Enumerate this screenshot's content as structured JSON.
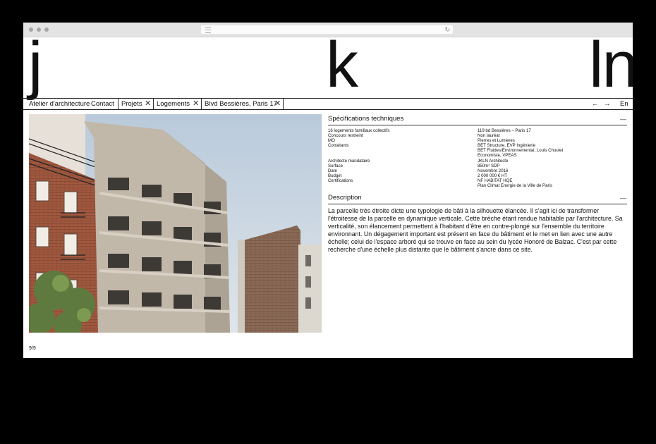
{
  "header": {
    "letter_1": "j",
    "letter_2": "k",
    "letter_3": "ln"
  },
  "nav": {
    "studio": "Atelier d'architecture",
    "contact": "Contact",
    "crumbs": [
      "Projets",
      "Logements",
      "Blvd Bessières, Paris 17"
    ],
    "prev_arrow": "←",
    "next_arrow": "→",
    "language": "En"
  },
  "specs": {
    "title": "Spécifications techniques",
    "collapse": "—",
    "labels": [
      "16 logements familiaux collectifs",
      "Concours restreint",
      "MO",
      "Cotraitants",
      "",
      "",
      "Architecte mandataire",
      "Surface",
      "Date",
      "Budget",
      "Certifications",
      ""
    ],
    "values": [
      "119 bd Bessières – Paris 17",
      "Non lauréat",
      "Pierres et Lumieres",
      "BET Structure, EVP Ingénierie",
      "BET Fluides/Environnemental, Louis Choulet",
      "Economiste, VPEAS",
      "JKLN Architecte",
      "850m² SDP",
      "Novembre 2016",
      "2 000 000 € HT",
      "NF HABITAT HQE",
      "Plan Climat Energie de la Ville de Paris"
    ]
  },
  "description": {
    "title": "Description",
    "collapse": "—",
    "text": "La parcelle très étroite dicte une typologie de bâti à la silhouette élancée. Il s'agit ici de transformer l'étroitesse de la parcelle en dynamique verticale. Cette brèche étant rendue habitable par l'architecture. Sa verticalité, son élancement permettent à l'habitant d'être en contre-plongé sur l'ensemble du territoire environnant. Un dégagement important est présent en face du bâtiment et le met en lien avec une autre échelle; celui de l'espace arboré qui se trouve en face au sein du lycée Honoré de Balzac. C'est par cette recherche d'une échelle plus distante que le bâtiment s'ancre dans ce site."
  },
  "pager": "9/9",
  "icons": {
    "close": "close-icon",
    "prev": "arrow-left-icon",
    "next": "arrow-right-icon"
  },
  "colors": {
    "background": "#000000",
    "page": "#ffffff",
    "text": "#111111",
    "chrome": "#e4e3e4"
  }
}
